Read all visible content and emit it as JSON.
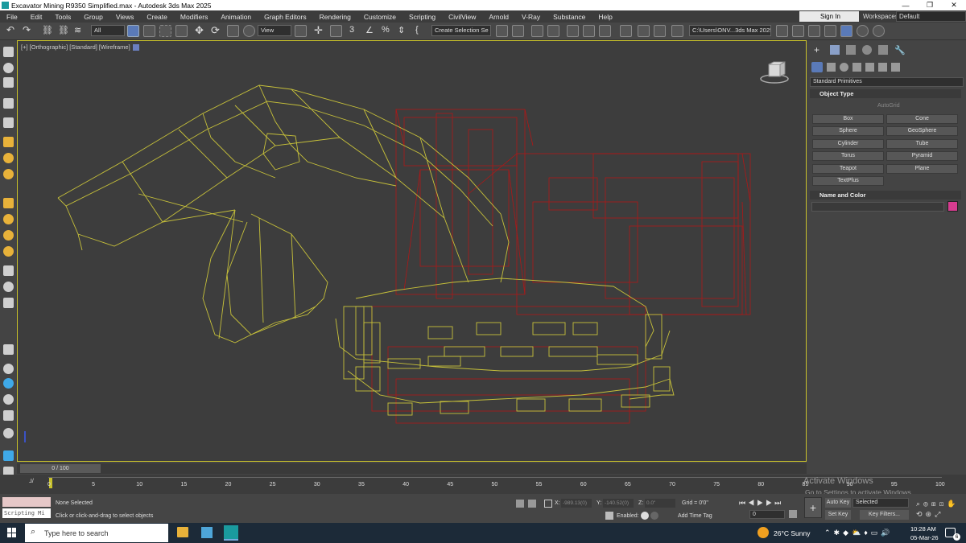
{
  "window": {
    "title": "Excavator Mining R9350 Simplified.max - Autodesk 3ds Max 2025",
    "min_glyph": "—",
    "max_glyph": "❐",
    "close_glyph": "✕"
  },
  "menu": [
    "File",
    "Edit",
    "Tools",
    "Group",
    "Views",
    "Create",
    "Modifiers",
    "Animation",
    "Graph Editors",
    "Rendering",
    "Customize",
    "Scripting",
    "CivilView",
    "Arnold",
    "V-Ray",
    "Substance",
    "Help"
  ],
  "account": {
    "sign_in": "Sign In",
    "workspaces_label": "Workspaces:",
    "workspace": "Default"
  },
  "toolbar": {
    "selection_filter": "All",
    "ref_coord": "View",
    "named_selection": "Create Selection Se",
    "path": "C:\\Users\\ONV...3ds Max 2025"
  },
  "viewport": {
    "label": "[+] [Orthographic] [Standard] [Wireframe]",
    "boom_color": "#c7c13a",
    "body_color": "#b01717",
    "frame_color": "#c9c22b"
  },
  "command_panel": {
    "category": "Standard Primitives",
    "object_type_title": "Object Type",
    "autogrid": "AutoGrid",
    "buttons": [
      "Box",
      "Cone",
      "Sphere",
      "GeoSphere",
      "Cylinder",
      "Tube",
      "Torus",
      "Pyramid",
      "Teapot",
      "Plane",
      "TextPlus"
    ],
    "name_color_title": "Name and Color",
    "object_color": "#d63c8f"
  },
  "timeline": {
    "slider": "0 / 100",
    "ticks": [
      "0",
      "5",
      "10",
      "15",
      "20",
      "25",
      "30",
      "35",
      "40",
      "45",
      "50",
      "55",
      "60",
      "65",
      "70",
      "75",
      "80",
      "85",
      "90",
      "95",
      "100"
    ]
  },
  "status": {
    "script_listener": "Scripting Mi",
    "selection": "None Selected",
    "prompt": "Click or click-and-drag to select objects",
    "x_label": "X:",
    "x_value": "-989.13(0)",
    "y_label": "Y:",
    "y_value": "-140.52(0)",
    "z_label": "Z:",
    "z_value": "0.0\"",
    "grid": "Grid = 0'0\"",
    "enabled": "Enabled:",
    "add_time_tag": "Add Time Tag",
    "frame": "0",
    "auto_key": "Auto Key",
    "selected": "Selected",
    "set_key": "Set Key",
    "key_filters": "Key Filters..."
  },
  "watermark": {
    "line1": "Activate Windows",
    "line2": "Go to Settings to activate Windows."
  },
  "taskbar": {
    "search": "Type here to search",
    "weather": "26°C  Sunny",
    "time": "10:28 AM",
    "date": "05-Mar-26",
    "notif": "6"
  }
}
